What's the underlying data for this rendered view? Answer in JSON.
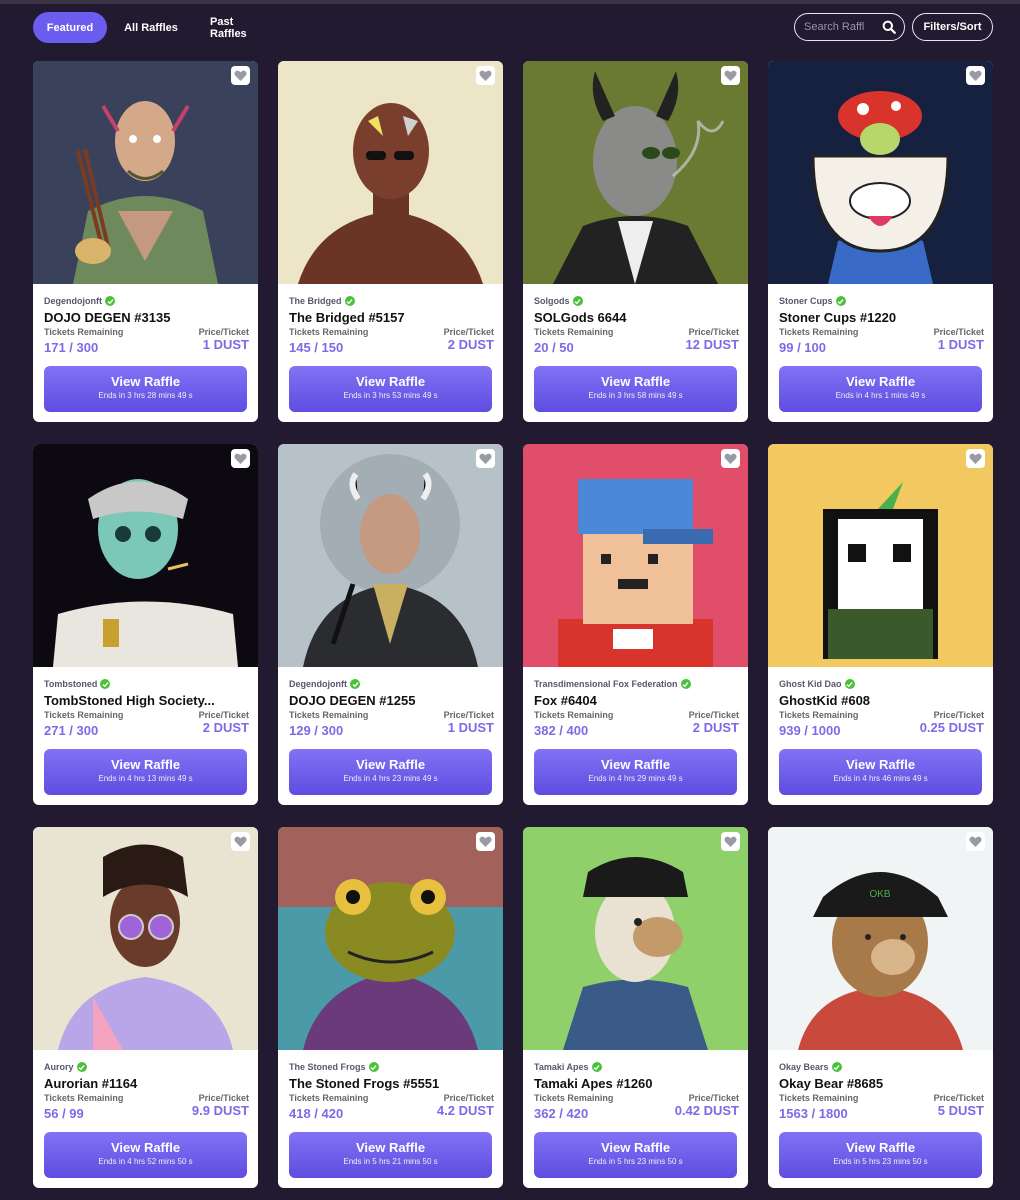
{
  "nav": {
    "tabs": [
      {
        "label": "Featured",
        "active": true
      },
      {
        "label": "All Raffles",
        "active": false
      },
      {
        "label": "Past Raffles",
        "active": false
      }
    ],
    "search_placeholder": "Search Raffl",
    "filters_label": "Filters/Sort"
  },
  "labels": {
    "tickets": "Tickets Remaining",
    "price": "Price/Ticket",
    "button": "View Raffle"
  },
  "colors": {
    "accent": "#6a5df0",
    "background": "#221a30",
    "value": "#7c6ae8",
    "verified": "#49c23a"
  },
  "cards": [
    {
      "collection": "Degendojonft",
      "name": "DOJO DEGEN #3135",
      "tickets": "171 / 300",
      "price": "1 DUST",
      "ends": "Ends in 3 hrs 28 mins 49 s",
      "art": "dojo"
    },
    {
      "collection": "The Bridged",
      "name": "The Bridged #5157",
      "tickets": "145 / 150",
      "price": "2 DUST",
      "ends": "Ends in 3 hrs 53 mins 49 s",
      "art": "bridged"
    },
    {
      "collection": "Solgods",
      "name": "SOLGods 6644",
      "tickets": "20 / 50",
      "price": "12 DUST",
      "ends": "Ends in 3 hrs 58 mins 49 s",
      "art": "solgod"
    },
    {
      "collection": "Stoner Cups",
      "name": "Stoner Cups #1220",
      "tickets": "99 / 100",
      "price": "1 DUST",
      "ends": "Ends in 4 hrs 1 mins 49 s",
      "art": "cup"
    },
    {
      "collection": "Tombstoned",
      "name": "TombStoned High Society...",
      "tickets": "271 / 300",
      "price": "2 DUST",
      "ends": "Ends in 4 hrs 13 mins 49 s",
      "art": "tomb"
    },
    {
      "collection": "Degendojonft",
      "name": "DOJO DEGEN #1255",
      "tickets": "129 / 300",
      "price": "1 DUST",
      "ends": "Ends in 4 hrs 23 mins 49 s",
      "art": "dojo2"
    },
    {
      "collection": "Transdimensional Fox Federation",
      "name": "Fox #6404",
      "tickets": "382 / 400",
      "price": "2 DUST",
      "ends": "Ends in 4 hrs 29 mins 49 s",
      "art": "fox"
    },
    {
      "collection": "Ghost Kid Dao",
      "name": "GhostKid #608",
      "tickets": "939 / 1000",
      "price": "0.25 DUST",
      "ends": "Ends in 4 hrs 46 mins 49 s",
      "art": "ghost"
    },
    {
      "collection": "Aurory",
      "name": "Aurorian #1164",
      "tickets": "56 / 99",
      "price": "9.9 DUST",
      "ends": "Ends in 4 hrs 52 mins 50 s",
      "art": "aurory"
    },
    {
      "collection": "The Stoned Frogs",
      "name": "The Stoned Frogs #5551",
      "tickets": "418 / 420",
      "price": "4.2 DUST",
      "ends": "Ends in 5 hrs 21 mins 50 s",
      "art": "frog"
    },
    {
      "collection": "Tamaki Apes",
      "name": "Tamaki Apes #1260",
      "tickets": "362 / 420",
      "price": "0.42 DUST",
      "ends": "Ends in 5 hrs 23 mins 50 s",
      "art": "ape"
    },
    {
      "collection": "Okay Bears",
      "name": "Okay Bear #8685",
      "tickets": "1563 / 1800",
      "price": "5 DUST",
      "ends": "Ends in 5 hrs 23 mins 50 s",
      "art": "bear"
    }
  ],
  "art_bin_text": "OKB"
}
